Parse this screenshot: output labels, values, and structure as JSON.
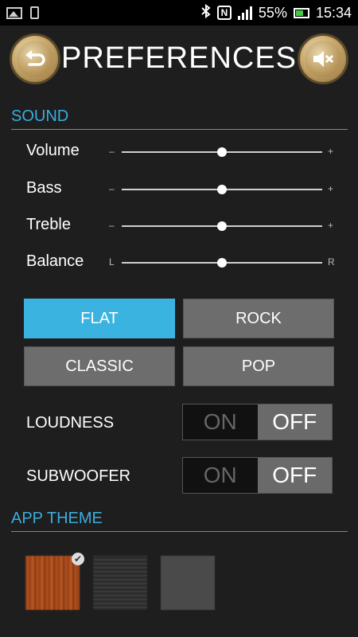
{
  "status_bar": {
    "icons": [
      "gallery-icon",
      "phone-icon",
      "bluetooth-icon",
      "nfc-icon",
      "signal-icon",
      "battery-icon"
    ],
    "nfc_label": "N",
    "battery": "55%",
    "time": "15:34"
  },
  "header": {
    "title": "PREFERENCES",
    "back_icon": "back-arrow-icon",
    "mute_icon": "speaker-mute-icon"
  },
  "sound": {
    "section_title": "SOUND",
    "sliders": [
      {
        "label": "Volume",
        "min_label": "–",
        "max_label": "+",
        "level": 0.5
      },
      {
        "label": "Bass",
        "min_label": "–",
        "max_label": "+",
        "level": 0.5
      },
      {
        "label": "Treble",
        "min_label": "–",
        "max_label": "+",
        "level": 0.5
      },
      {
        "label": "Balance",
        "min_label": "L",
        "max_label": "R",
        "level": 0.5
      }
    ],
    "presets": [
      {
        "label": "FLAT",
        "active": true
      },
      {
        "label": "ROCK",
        "active": false
      },
      {
        "label": "CLASSIC",
        "active": false
      },
      {
        "label": "POP",
        "active": false
      }
    ],
    "toggles": [
      {
        "label": "LOUDNESS",
        "on_label": "ON",
        "off_label": "OFF",
        "value": "OFF"
      },
      {
        "label": "SUBWOOFER",
        "on_label": "ON",
        "off_label": "OFF",
        "value": "OFF"
      }
    ]
  },
  "theme": {
    "section_title": "APP THEME",
    "swatches": [
      "wood",
      "dark-lines",
      "gray"
    ],
    "selected": "wood",
    "check_mark": "✔"
  },
  "colors": {
    "accent": "#3ab3e0",
    "background": "#1e1e1e"
  }
}
